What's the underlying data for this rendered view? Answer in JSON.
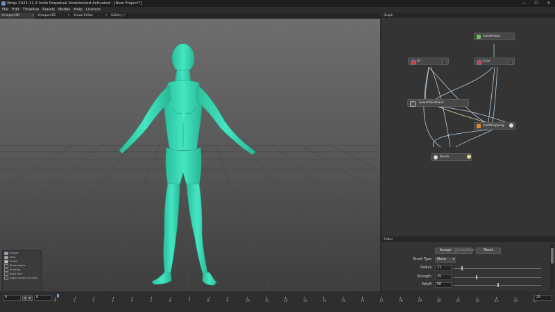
{
  "window": {
    "title": "Wrap 2021.11.3 Indie Perpetual Nodelocked Activated - [New Project*]",
    "controls": [
      "—",
      "☐",
      "✕"
    ]
  },
  "menu": [
    "File",
    "Edit",
    "Timeline",
    "Panels",
    "Nodes",
    "Help",
    "Licence"
  ],
  "tabs": [
    {
      "label": "Viewport3D"
    },
    {
      "label": "Viewport3D"
    },
    {
      "label": "Visual Editor"
    },
    {
      "label": "Gallery"
    }
  ],
  "viewport": {
    "legend": [
      "Visible",
      "Wire",
      "Points",
      "Show labels",
      "Shading",
      "Back face",
      "Align camera to area"
    ]
  },
  "graph": {
    "title": "Graph",
    "nodes": [
      {
        "label": "LoadImage",
        "icon": "image-icon"
      },
      {
        "label": "Gf",
        "icon": "shield-icon"
      },
      {
        "label": "Crov",
        "icon": "shield-icon"
      },
      {
        "label": "SelectPointPairs",
        "icon": "select-points-icon"
      },
      {
        "label": "FastWrapping",
        "icon": "wrap-icon"
      },
      {
        "label": "Brush",
        "icon": "brush-icon"
      }
    ]
  },
  "editor": {
    "title": "Editor",
    "accept": "Accept",
    "undo": "Undo/Redo",
    "reset": "Reset",
    "brush_type_label": "Brush Type",
    "brush_type_value": "Move",
    "radius_label": "Radius",
    "radius_value": "11",
    "radius_level": 0.09,
    "strength_label": "Strength",
    "strength_value": "25",
    "strength_level": 0.25,
    "falloff_label": "Falloff",
    "falloff_value": "50",
    "falloff_level": 0.5
  },
  "timeline": {
    "start": "0",
    "current": "0",
    "end": "25",
    "ticks": [
      "0",
      "1",
      "2",
      "3",
      "4",
      "5",
      "6",
      "7",
      "8",
      "9",
      "10",
      "11",
      "12",
      "13",
      "14",
      "15",
      "16",
      "17",
      "18",
      "19",
      "20",
      "21",
      "22",
      "23",
      "24",
      "25"
    ]
  }
}
